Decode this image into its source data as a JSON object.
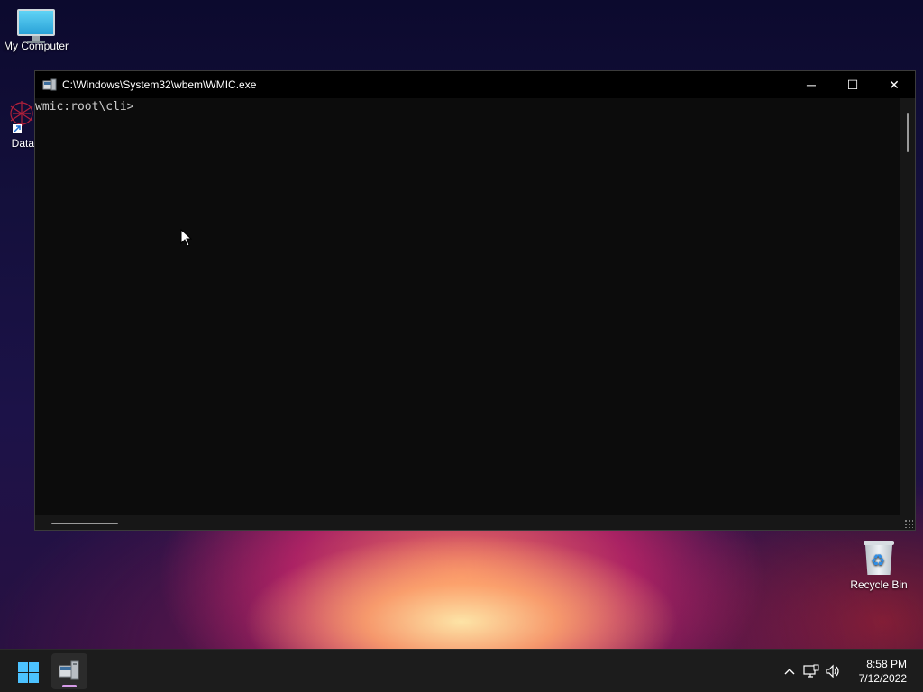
{
  "desktop": {
    "icons": [
      {
        "label": "My Computer"
      },
      {
        "label": "DataW"
      },
      {
        "label": "Recycle Bin"
      }
    ]
  },
  "window": {
    "title": "C:\\Windows\\System32\\wbem\\WMIC.exe",
    "controls": {
      "minimize": "─",
      "maximize": "☐",
      "close": "✕"
    },
    "console_text": "wmic:root\\cli>"
  },
  "taskbar": {
    "tray": {
      "chevron": "^",
      "network_icon": "network-icon",
      "volume_icon": "volume-icon"
    },
    "clock": {
      "time": "8:58 PM",
      "date": "7/12/2022"
    }
  },
  "colors": {
    "console_bg": "#0c0c0c",
    "console_text": "#cccccc",
    "start_accent": "#4cc2ff",
    "app_indicator": "#d69be8"
  }
}
